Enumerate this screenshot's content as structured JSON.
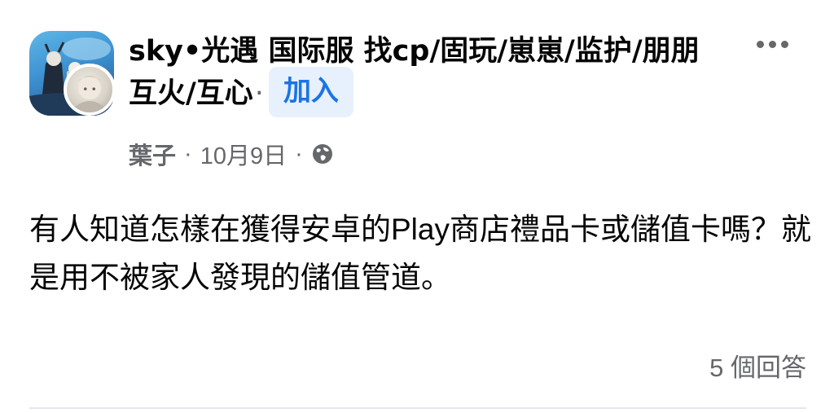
{
  "post": {
    "group_name": "sky•光遇 国际服 找cp/固玩/崽崽/监护/朋朋 互火/互心",
    "separator": "·",
    "join_label": "加入",
    "author": "葉子",
    "date": "10月9日",
    "meta_separator": "·",
    "privacy_icon": "globe-icon",
    "more_icon": "more-dots-icon",
    "body": "有人知道怎樣在獲得安卓的Play商店禮品卡或儲值卡嗎？就是用不被家人發現的儲值管道。",
    "answers_count": "5 個回答"
  },
  "colors": {
    "accent": "#1b74e4",
    "join_bg": "#e7f0fd",
    "secondary_text": "#65676b",
    "primary_text": "#050505"
  }
}
